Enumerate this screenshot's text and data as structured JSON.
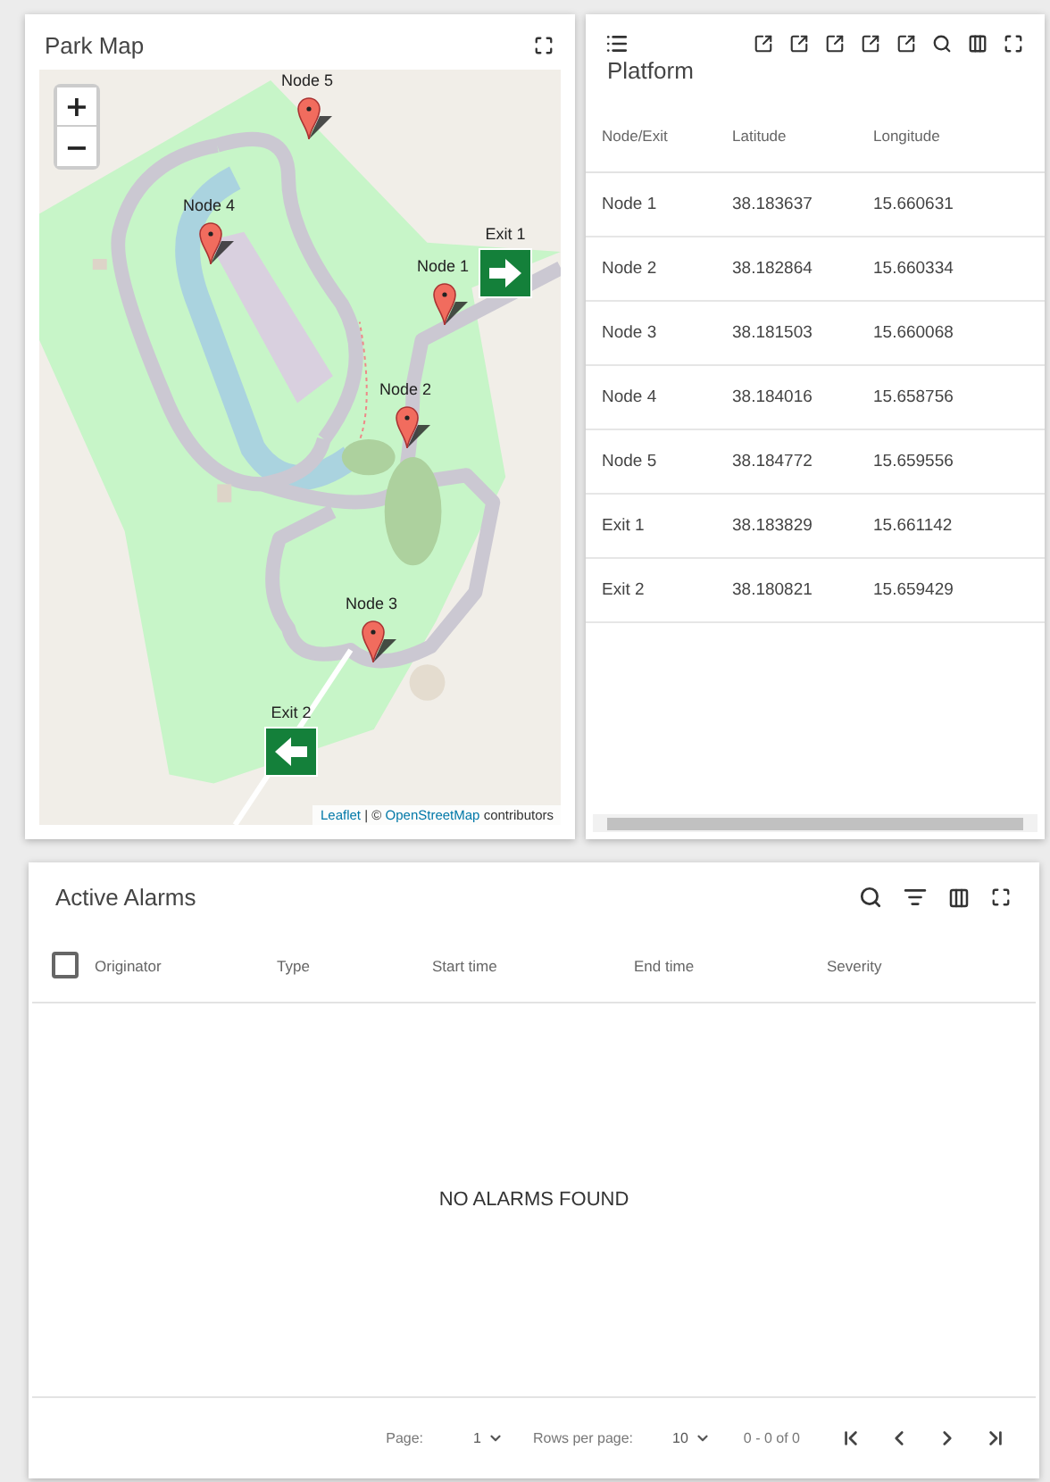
{
  "map": {
    "title": "Park Map",
    "zoom_in": "+",
    "zoom_out": "−",
    "markers": [
      {
        "kind": "pin",
        "label": "Node 5"
      },
      {
        "kind": "pin",
        "label": "Node 4"
      },
      {
        "kind": "exit",
        "label": "Exit 1",
        "mirrored": false
      },
      {
        "kind": "pin",
        "label": "Node 1"
      },
      {
        "kind": "pin",
        "label": "Node 2"
      },
      {
        "kind": "pin",
        "label": "Node 3"
      },
      {
        "kind": "exit",
        "label": "Exit 2",
        "mirrored": true
      }
    ],
    "attribution": [
      {
        "kind": "link",
        "text": "Leaflet"
      },
      {
        "kind": "text",
        "text": "| ©"
      },
      {
        "kind": "link",
        "text": "OpenStreetMap"
      },
      {
        "kind": "text",
        "text": "contributors"
      }
    ]
  },
  "platform": {
    "title": "Platform",
    "columns": [
      "Node/Exit",
      "Latitude",
      "Longitude"
    ],
    "rows": [
      [
        "Node 1",
        "38.183637",
        "15.660631"
      ],
      [
        "Node 2",
        "38.182864",
        "15.660334"
      ],
      [
        "Node 3",
        "38.181503",
        "15.660068"
      ],
      [
        "Node 4",
        "38.184016",
        "15.658756"
      ],
      [
        "Node 5",
        "38.184772",
        "15.659556"
      ],
      [
        "Exit 1",
        "38.183829",
        "15.661142"
      ],
      [
        "Exit 2",
        "38.180821",
        "15.659429"
      ]
    ]
  },
  "alarms": {
    "title": "Active Alarms",
    "select_all_checked": false,
    "columns": [
      "Originator",
      "Type",
      "Start time",
      "End time",
      "Severity"
    ],
    "empty_message": "NO ALARMS FOUND",
    "pagination": {
      "page_label": "Page:",
      "page": "1",
      "rows_label": "Rows per page:",
      "rows_per_page": "10",
      "range": "0 - 0 of 0"
    }
  }
}
